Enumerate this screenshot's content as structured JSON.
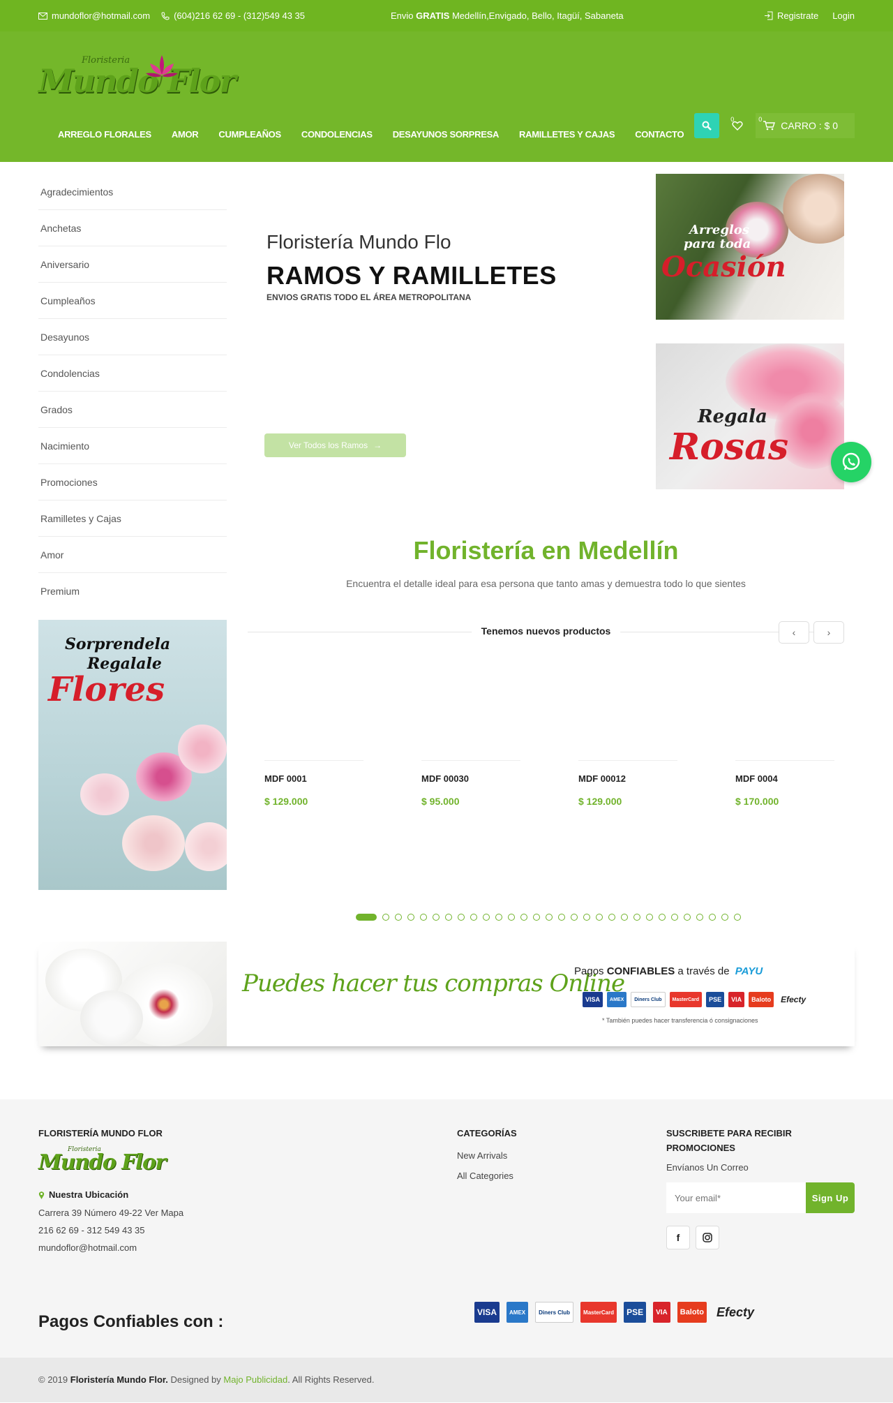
{
  "topbar": {
    "email": "mundoflor@hotmail.com",
    "phone": "(604)216 62 69 - (312)549 43 35",
    "ship_prefix": "Envio",
    "ship_bold": "GRATIS",
    "ship_rest": "Medellín,Envigado, Bello, Itagüí, Sabaneta",
    "register": "Registrate",
    "login": "Login"
  },
  "header": {
    "logo_small": "Floristeria",
    "logo_main": "Mundo Flor",
    "nav": [
      "ARREGLO FLORALES",
      "AMOR",
      "CUMPLEAÑOS",
      "CONDOLENCIAS",
      "DESAYUNOS SORPRESA",
      "RAMILLETES Y CAJAS",
      "CONTACTO"
    ],
    "wishlist_count": "0",
    "cart_count": "0",
    "cart_label": "CARRO : $ 0"
  },
  "sidebar": {
    "items": [
      "Agradecimientos",
      "Anchetas",
      "Aniversario",
      "Cumpleaños",
      "Desayunos",
      "Condolencias",
      "Grados",
      "Nacimiento",
      "Promociones",
      "Ramilletes y Cajas",
      "Amor",
      "Premium"
    ],
    "banner": {
      "line1": "Sorprendela",
      "line2": "Regalale",
      "line3": "Flores"
    }
  },
  "hero": {
    "subtitle": "Floristería Mundo Flo",
    "title": "RAMOS Y RAMILLETES",
    "note": "ENVIOS GRATIS TODO EL ÁREA METROPOLITANA",
    "button": "Ver Todos los Ramos"
  },
  "promos": [
    {
      "line1": "Arreglos",
      "line2": "para toda",
      "line3": "Ocasión"
    },
    {
      "line1": "Regala",
      "line2": "Rosas"
    }
  ],
  "section": {
    "title": "Floristería en Medellín",
    "subtitle": "Encuentra el detalle ideal para esa persona que tanto amas y demuestra todo lo que sientes",
    "new_products": "Tenemos nuevos productos"
  },
  "products": [
    {
      "name": "MDF 0001",
      "price": "$ 129.000"
    },
    {
      "name": "MDF 00030",
      "price": "$ 95.000"
    },
    {
      "name": "MDF 00012",
      "price": "$ 129.000"
    },
    {
      "name": "MDF 0004",
      "price": "$ 170.000"
    }
  ],
  "online_banner": {
    "text": "Puedes hacer tus compras Online",
    "pay_prefix": "Pagos",
    "pay_bold": "CONFIABLES",
    "pay_suffix": "a través de",
    "payu": "PAYU",
    "note": "* También puedes hacer transferencia ó consignaciones"
  },
  "payment_logos": [
    "VISA",
    "AMEX",
    "Diners Club",
    "MasterCard",
    "PSE",
    "VIA",
    "Baloto",
    "Efecty"
  ],
  "footer": {
    "col1_title": "FLORISTERÍA MUNDO FLOR",
    "location_title": "Nuestra Ubicación",
    "address": "Carrera 39 Número 49-22 Ver Mapa",
    "phones": "216 62 69 - 312 549 43 35",
    "email": "mundoflor@hotmail.com",
    "col2_title": "CATEGORÍAS",
    "links": [
      "New Arrivals",
      "All Categories"
    ],
    "col3_title": "SUSCRIBETE PARA RECIBIR PROMOCIONES",
    "subscribe_text": "Envíanos Un Correo",
    "email_placeholder": "Your email*",
    "signup": "Sign Up",
    "payments_title": "Pagos Confiables con :"
  },
  "copyright": {
    "prefix": "© 2019",
    "brand": "Floristería Mundo Flor.",
    "designed": "Designed by",
    "designer": "Majo Publicidad",
    "rights": ". All Rights Reserved."
  },
  "colors": {
    "brand_green": "#74b72a",
    "accent_teal": "#2ed3b4",
    "red": "#d61e2a"
  }
}
